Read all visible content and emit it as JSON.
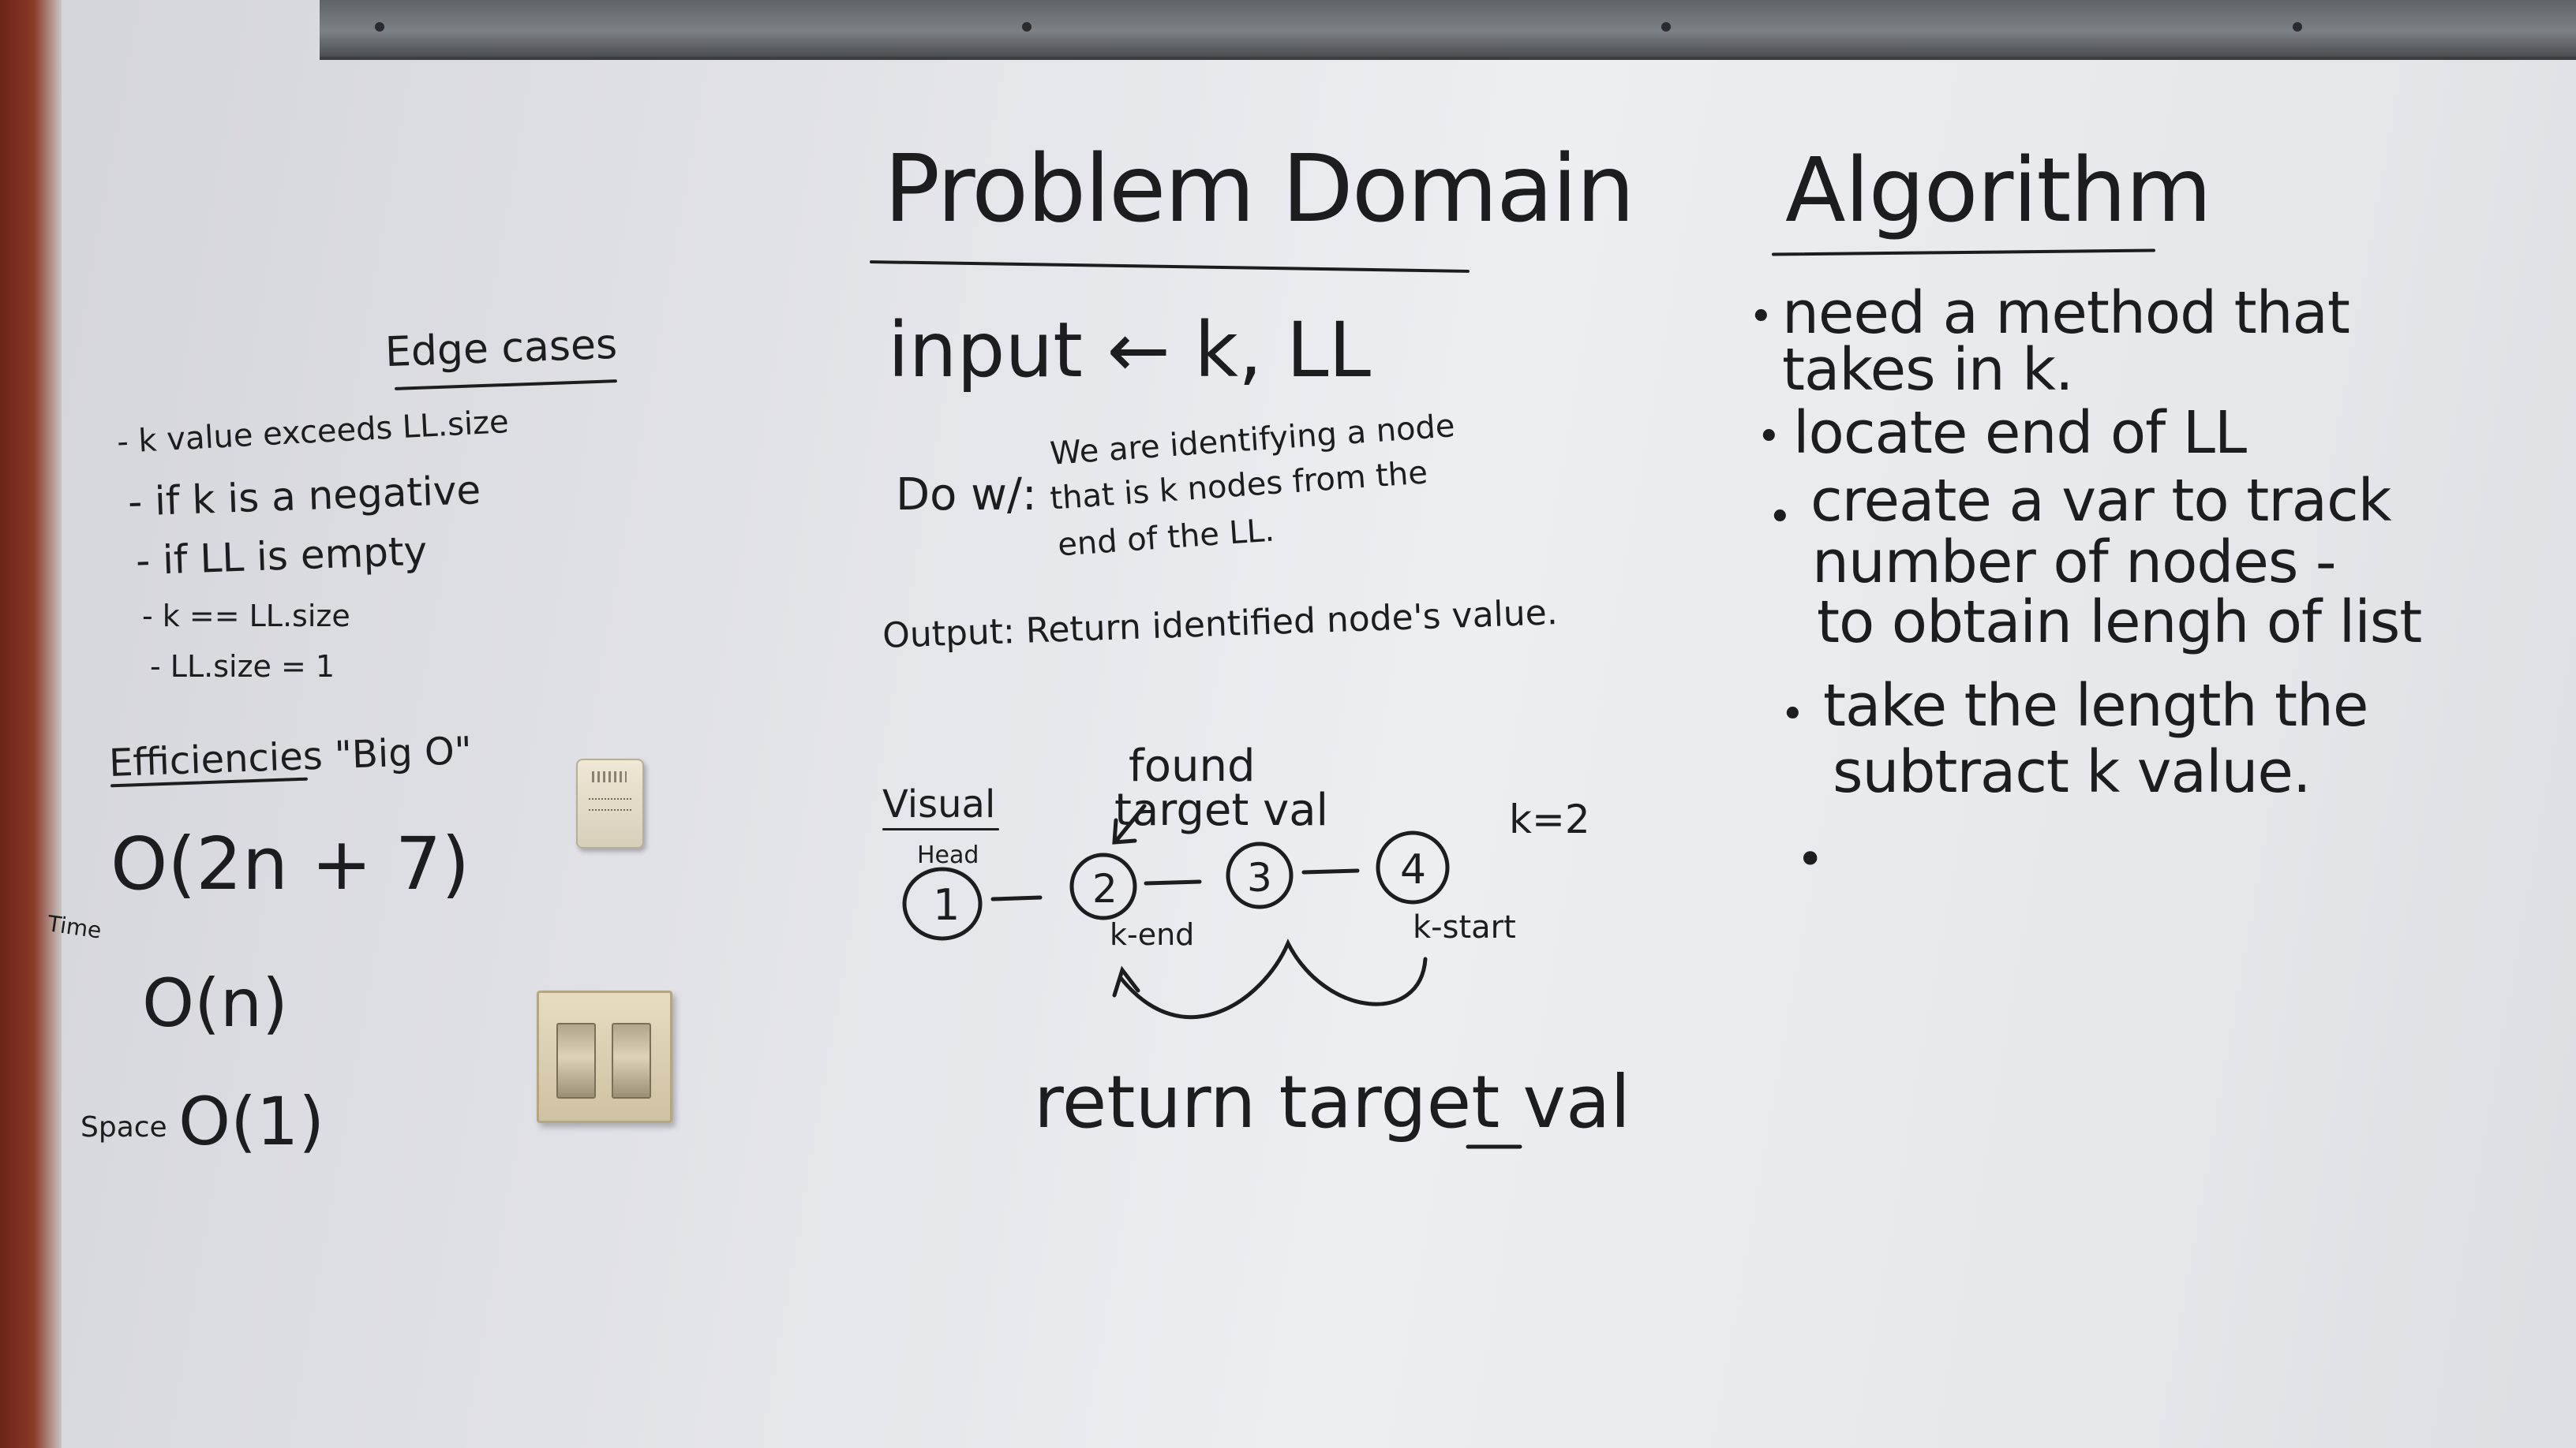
{
  "problem_domain": {
    "title": "Problem Domain",
    "input": "input ← k, LL",
    "do_w_label": "Do w/:",
    "do_w_lines": [
      "We are identifying a node",
      "that is k nodes from the",
      "end of the LL."
    ],
    "output": "Output: Return identified node's value."
  },
  "edge_cases": {
    "title": "Edge cases",
    "items": [
      "- k value exceeds LL.size",
      "- if k is a negative",
      "- if LL is empty",
      "- k == LL.size",
      "- LL.size = 1"
    ]
  },
  "efficiencies": {
    "title": "Efficiencies \"Big O\"",
    "time_label": "Time",
    "time_items": [
      "O(2n + 7)",
      "O(n)"
    ],
    "space_label": "Space",
    "space_value": "O(1)"
  },
  "algorithm": {
    "title": "Algorithm",
    "steps": [
      [
        "need a method that",
        "takes in k."
      ],
      [
        "locate end of LL"
      ],
      [
        "create a var to track",
        "number of nodes -",
        "to obtain lengh of list"
      ],
      [
        "take the length the",
        "subtract k value."
      ]
    ],
    "empty_bullet": "•"
  },
  "visual": {
    "label": "Visual",
    "head_label": "Head",
    "found_label_line1": "found",
    "found_label_line2": "target val",
    "k_label": "k=2",
    "nodes": [
      "1",
      "2",
      "3",
      "4"
    ],
    "k_end_label": "k-end",
    "k_start_label": "k-start",
    "return_label": "return target val"
  },
  "colors": {
    "ink": "#1d1d20",
    "board": "#e6e8ec",
    "frame": "#8a3a28"
  }
}
